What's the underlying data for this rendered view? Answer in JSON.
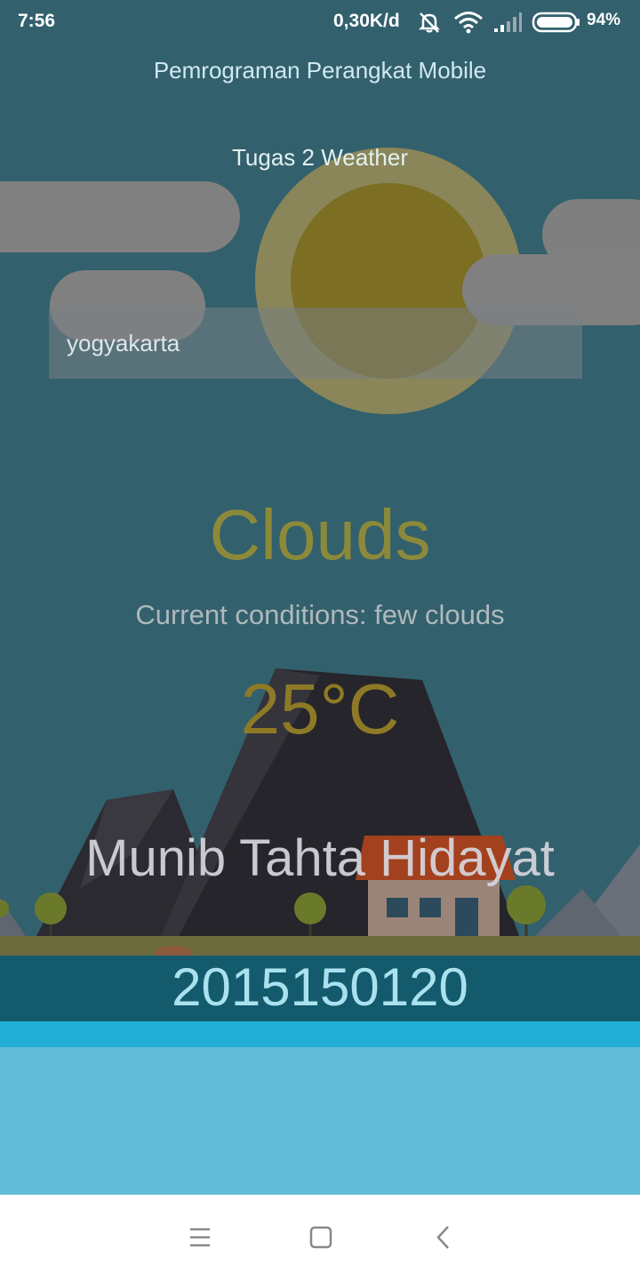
{
  "status_bar": {
    "time": "7:56",
    "network_speed": "0,30K/d",
    "battery_percent": "94%",
    "icons": [
      "mute-icon",
      "wifi-icon",
      "signal-icon",
      "battery-icon"
    ]
  },
  "app": {
    "title": "Pemrograman Perangkat Mobile",
    "subtitle": "Tugas 2 Weather"
  },
  "search": {
    "city_value": "yogyakarta"
  },
  "weather": {
    "main": "Clouds",
    "description": "Current conditions: few clouds",
    "temperature": "25°C"
  },
  "student": {
    "name": "Munib Tahta Hidayat",
    "id": "2015150120"
  },
  "nav": {
    "icons": [
      "menu-icon",
      "home-icon",
      "back-icon"
    ]
  },
  "colors": {
    "sky": "#33606d",
    "sun_outer": "#8a8659",
    "sun_inner": "#7c6e22",
    "cloud": "#808080",
    "mountain": "#2b2a30",
    "ground": "#6b6b3c",
    "water_dark": "#135a6d",
    "water_bright": "#22aed6",
    "water_light": "#61bcd8"
  }
}
